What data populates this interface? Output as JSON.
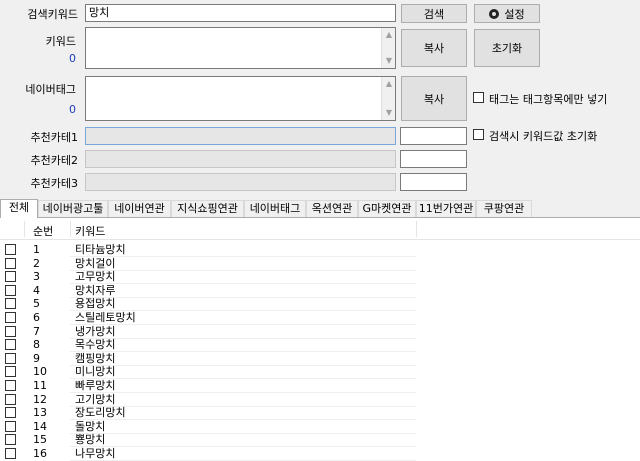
{
  "form": {
    "search_keyword_label": "검색키워드",
    "search_keyword_value": "망치",
    "search_button": "검색",
    "settings_button": "설정",
    "keyword_label": "키워드",
    "keyword_count": "0",
    "keyword_copy_button": "복사",
    "reset_button": "초기화",
    "naver_tag_label": "네이버태그",
    "naver_tag_count": "0",
    "naver_tag_copy_button": "복사",
    "tag_only_checkbox": "태그는 태그항목에만 넣기",
    "reset_on_search_checkbox": "검색시 키워드값 초기화",
    "rec_cat1_label": "추천카테1",
    "rec_cat2_label": "추천카테2",
    "rec_cat3_label": "추천카테3"
  },
  "tabs": [
    {
      "label": "전체"
    },
    {
      "label": "네이버광고툴"
    },
    {
      "label": "네이버연관"
    },
    {
      "label": "지식쇼핑연관"
    },
    {
      "label": "네이버태그"
    },
    {
      "label": "옥션연관"
    },
    {
      "label": "G마켓연관"
    },
    {
      "label": "11번가연관"
    },
    {
      "label": "쿠팡연관"
    }
  ],
  "table": {
    "col_no": "순번",
    "col_keyword": "키워드",
    "rows": [
      {
        "no": "1",
        "keyword": "티타늄망치"
      },
      {
        "no": "2",
        "keyword": "망치걸이"
      },
      {
        "no": "3",
        "keyword": "고무망치"
      },
      {
        "no": "4",
        "keyword": "망치자루"
      },
      {
        "no": "5",
        "keyword": "용접망치"
      },
      {
        "no": "6",
        "keyword": "스틸레토망치"
      },
      {
        "no": "7",
        "keyword": "냉가망치"
      },
      {
        "no": "8",
        "keyword": "목수망치"
      },
      {
        "no": "9",
        "keyword": "캠핑망치"
      },
      {
        "no": "10",
        "keyword": "미니망치"
      },
      {
        "no": "11",
        "keyword": "빠루망치"
      },
      {
        "no": "12",
        "keyword": "고기망치"
      },
      {
        "no": "13",
        "keyword": "장도리망치"
      },
      {
        "no": "14",
        "keyword": "돌망치"
      },
      {
        "no": "15",
        "keyword": "뿅망치"
      },
      {
        "no": "16",
        "keyword": "나무망치"
      }
    ]
  }
}
